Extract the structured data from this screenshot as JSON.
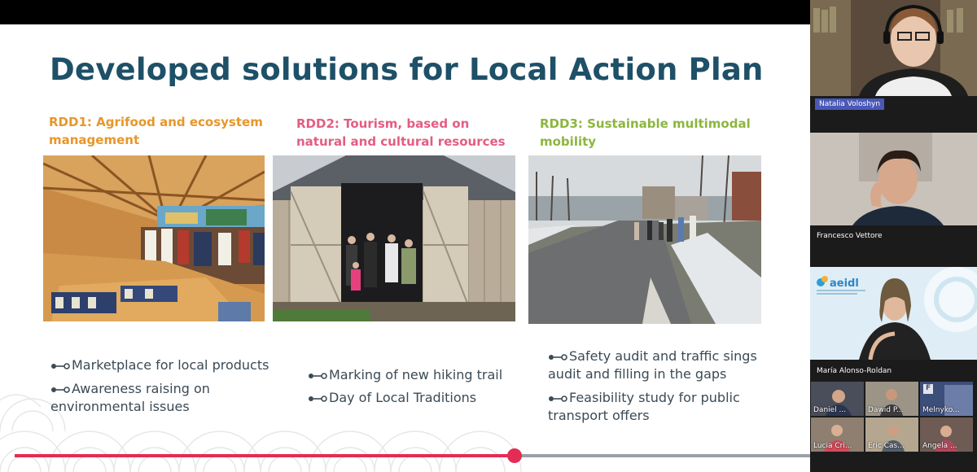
{
  "slide": {
    "title": "Developed solutions for Local Action Plan",
    "columns": [
      {
        "heading": "RDD1: Agrifood and ecosystem management",
        "color": "#e8962a",
        "photo": "market-stall-photo",
        "bullets": [
          "Marketplace for local products",
          "Awareness raising on environmental issues"
        ]
      },
      {
        "heading": "RDD2: Tourism, based on natural and cultural resources",
        "color": "#e35d83",
        "photo": "wooden-barn-photo",
        "bullets": [
          "Marking of new hiking trail",
          "Day of Local Traditions"
        ]
      },
      {
        "heading": "RDD3: Sustainable multimodal mobility",
        "color": "#8cb63e",
        "photo": "village-road-photo",
        "bullets": [
          "Safety audit and traffic sings audit and filling in the gaps",
          "Feasibility study for public transport offers"
        ]
      }
    ],
    "title_color": "#1e5068",
    "bullet_icon": "connector-icon"
  },
  "playback": {
    "progress": 0.628,
    "color": "#e32d54"
  },
  "participants": {
    "main": [
      {
        "name": "Natalia Voloshyn",
        "speaking": true
      },
      {
        "name": "Francesco Vettore"
      },
      {
        "name": "María Alonso-Roldan",
        "org_logo": "aeidl"
      }
    ],
    "thumbnails": [
      {
        "name": "Daniel ..."
      },
      {
        "name": "Dawid P..."
      },
      {
        "name": "Melnyko...",
        "initial": "F"
      },
      {
        "name": "Lucia Cri..."
      },
      {
        "name": "Eric Cas..."
      },
      {
        "name": "Angela ..."
      }
    ]
  }
}
